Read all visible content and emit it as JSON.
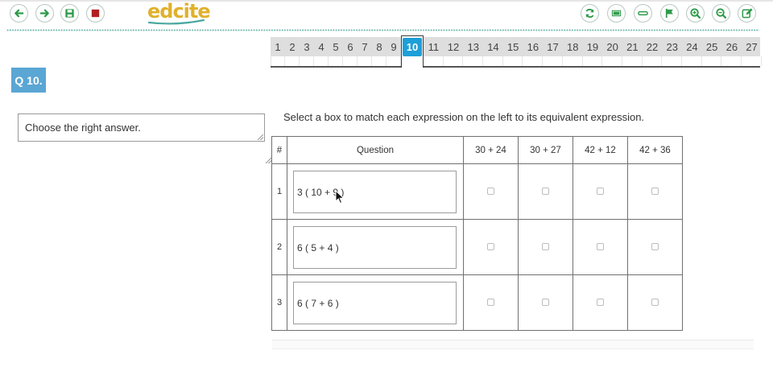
{
  "app": {
    "logo_text": "edcite"
  },
  "toolbar": {
    "left": [
      {
        "icon": "arrow-left-icon",
        "color": "#2e9a4a"
      },
      {
        "icon": "arrow-right-icon",
        "color": "#2e9a4a"
      },
      {
        "icon": "save-icon",
        "color": "#2e9a4a"
      },
      {
        "icon": "stop-icon",
        "color": "#b02020"
      }
    ],
    "right": [
      {
        "icon": "refresh-icon",
        "color": "#2e9a4a"
      },
      {
        "icon": "fullscreen-icon",
        "color": "#2e9a4a"
      },
      {
        "icon": "minus-pill-icon",
        "color": "#2e9a4a"
      },
      {
        "icon": "flag-icon",
        "color": "#2e9a4a"
      },
      {
        "icon": "zoom-in-icon",
        "color": "#2e9a4a"
      },
      {
        "icon": "zoom-out-icon",
        "color": "#2e9a4a"
      },
      {
        "icon": "edit-icon",
        "color": "#2e9a4a"
      }
    ]
  },
  "pager": {
    "pages": [
      "1",
      "2",
      "3",
      "4",
      "5",
      "6",
      "7",
      "8",
      "9",
      "10",
      "11",
      "12",
      "13",
      "14",
      "15",
      "16",
      "17",
      "18",
      "19",
      "20",
      "21",
      "22",
      "23",
      "24",
      "25",
      "26",
      "27"
    ],
    "active": "10",
    "active_color": "#1e9fd8"
  },
  "question": {
    "badge": "Q 10.",
    "hint_placeholder": "Choose the right answer.",
    "instruction": "Select a box to match each expression on the left to its equivalent expression."
  },
  "table": {
    "headers": {
      "num": "#",
      "question": "Question"
    },
    "options": [
      "30 + 24",
      "30 + 27",
      "42 + 12",
      "42 + 36"
    ],
    "rows": [
      {
        "num": "1",
        "expression": "3 ( 10 + 9 )"
      },
      {
        "num": "2",
        "expression": "6 ( 5 + 4 )"
      },
      {
        "num": "3",
        "expression": "6 ( 7 + 6 )"
      }
    ]
  }
}
